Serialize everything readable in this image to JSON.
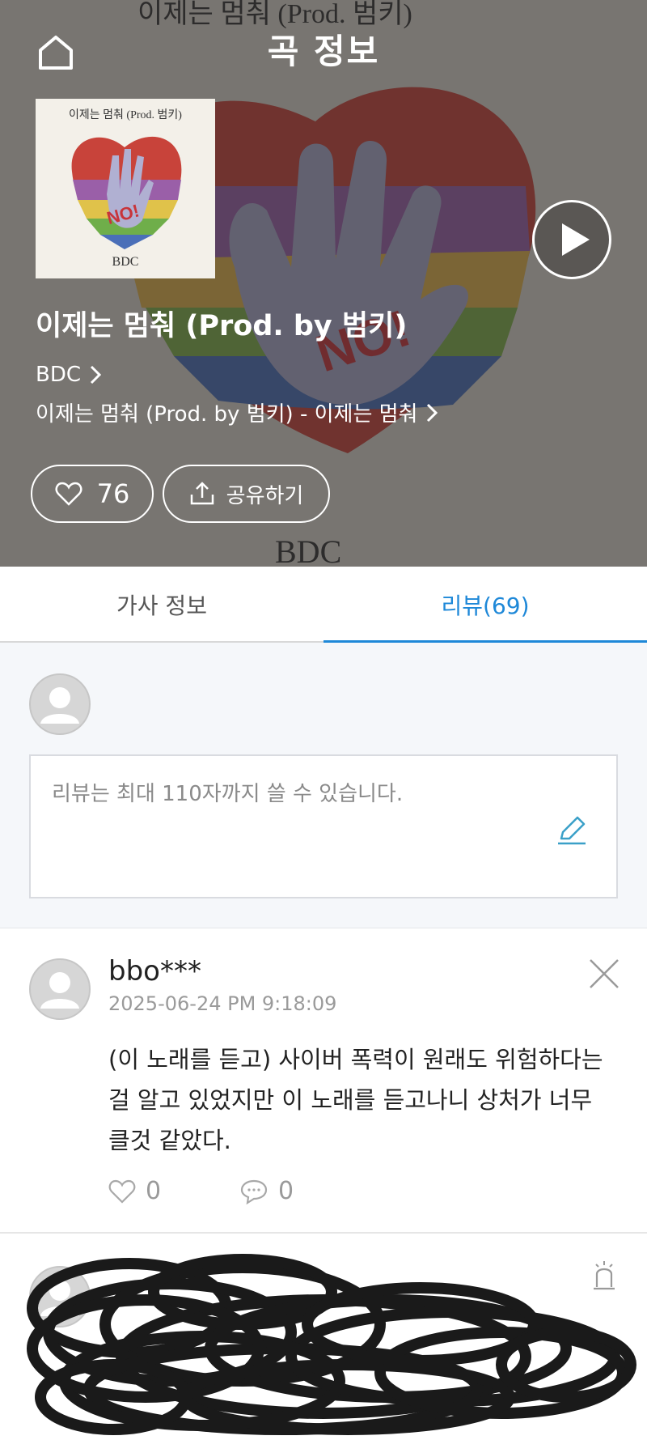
{
  "header": {
    "title": "곡 정보"
  },
  "song": {
    "title": "이제는 멈춰 (Prod. by 범키)",
    "artist": "BDC",
    "album": "이제는 멈춰 (Prod. by 범키) - 이제는 멈춰",
    "album_art_caption": "이제는 멈춰 (Prod. 범키)",
    "album_art_signature": "BDC",
    "album_art_no": "NO!"
  },
  "actions": {
    "like_count": "76",
    "share_label": "공유하기"
  },
  "tabs": [
    {
      "label": "가사 정보",
      "active": false
    },
    {
      "label": "리뷰(69)",
      "active": true
    }
  ],
  "write": {
    "placeholder": "리뷰는 최대 110자까지 쓸 수 있습니다."
  },
  "reviews": [
    {
      "user": "bbo***",
      "date": "2025-06-24 PM 9:18:09",
      "text": "(이 노래를 듣고) 사이버 폭력이 원래도 위험하다는걸 알고 있었지만 이 노래를 듣고나니 상처가 너무 클것 같았다.",
      "likes": "0",
      "comments": "0"
    }
  ],
  "colors": {
    "accent": "#1e88d8",
    "hero_overlay": "#3c3a3a",
    "pen": "#3aa0c8"
  },
  "icons": {
    "home": "home-icon",
    "play": "play-icon",
    "heart": "heart-icon",
    "share": "share-icon",
    "pen": "pen-icon",
    "close": "close-icon",
    "comment": "comment-icon",
    "report": "report-icon"
  }
}
